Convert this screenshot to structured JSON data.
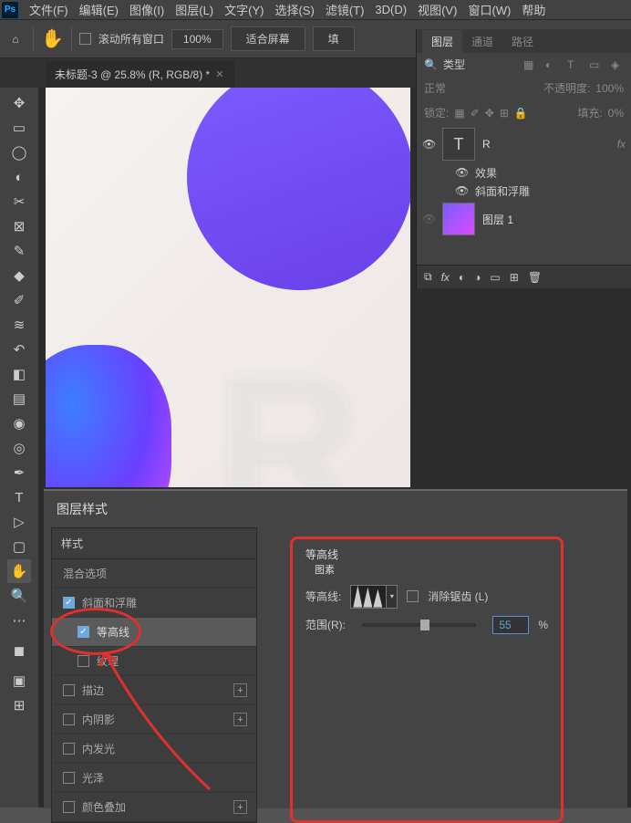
{
  "menu": {
    "file": "文件(F)",
    "edit": "编辑(E)",
    "image": "图像(I)",
    "layer": "图层(L)",
    "type": "文字(Y)",
    "select": "选择(S)",
    "filter": "滤镜(T)",
    "threed": "3D(D)",
    "view": "视图(V)",
    "window": "窗口(W)",
    "help": "帮助"
  },
  "options": {
    "scroll_all": "滚动所有窗口",
    "zoom": "100%",
    "fit": "适合屏幕",
    "fill": "填"
  },
  "doc_tab": "未标题-3 @ 25.8% (R, RGB/8) *",
  "panels": {
    "layers": "图层",
    "channels": "通道",
    "paths": "路径",
    "search_label": "类型",
    "blend": "正常",
    "opacity_label": "不透明度:",
    "opacity": "100%",
    "lock": "锁定:",
    "fill_label": "填充:",
    "fill": "0%",
    "layer_r": "R",
    "effects": "效果",
    "bevel": "斜面和浮雕",
    "layer1": "图层 1"
  },
  "dialog": {
    "title": "图层样式",
    "styles": "样式",
    "blend_options": "混合选项",
    "bevel": "斜面和浮雕",
    "contour": "等高线",
    "texture": "纹理",
    "stroke": "描边",
    "inner_shadow": "内阴影",
    "inner_glow": "内发光",
    "satin": "光泽",
    "color_overlay": "颜色叠加"
  },
  "contour_panel": {
    "title": "等高线",
    "sub": "图素",
    "contour_label": "等高线:",
    "antialias": "消除锯齿 (L)",
    "range": "范围(R):",
    "value": "55",
    "pct": "%"
  }
}
